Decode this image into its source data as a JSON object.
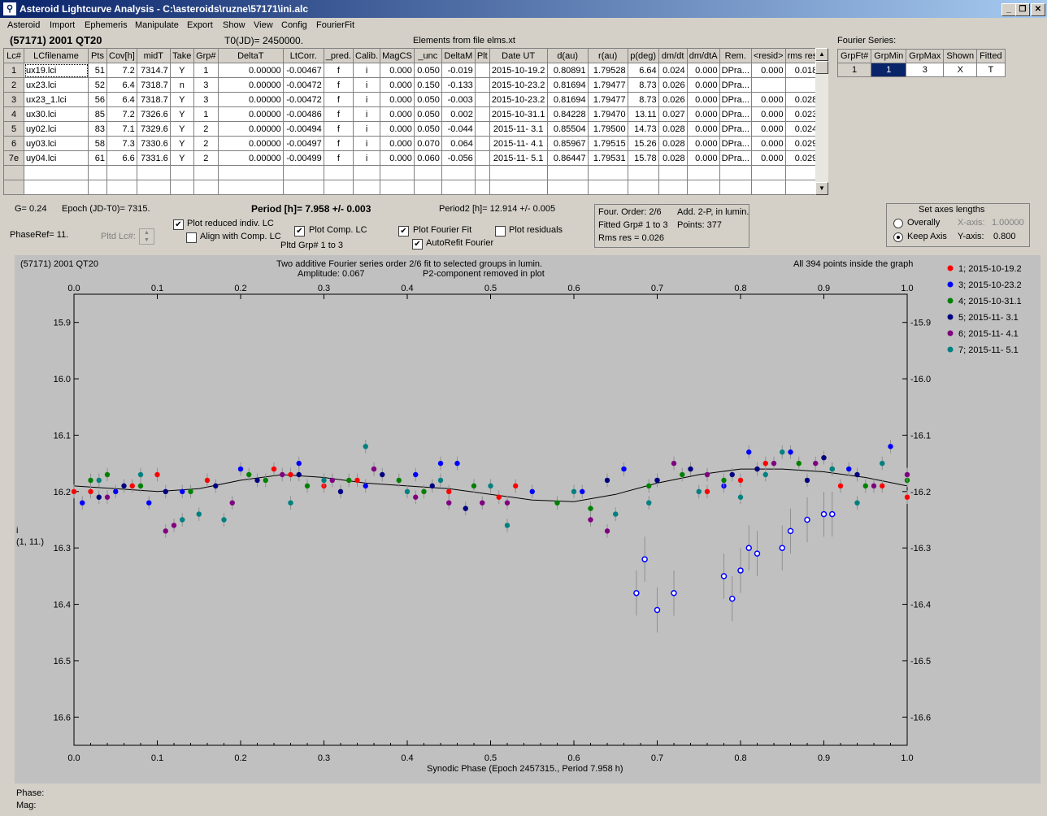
{
  "window": {
    "title": "Asteroid Lightcurve Analysis - C:\\asteroids\\ruzne\\57171\\ini.alc",
    "minimize": "_",
    "maximize": "❐",
    "close": "✕"
  },
  "menu": [
    "Asteroid",
    "Import",
    "Ephemeris",
    "Manipulate",
    "Export",
    "Show",
    "View",
    "Config",
    "FourierFit"
  ],
  "header": {
    "object": "(57171) 2001 QT20",
    "t0": "T0(JD)= 2450000.",
    "elements": "Elements from file elms.xt"
  },
  "table": {
    "columns": [
      "Lc#",
      "LCfilename",
      "Pts",
      "Cov[h]",
      "midT",
      "Take",
      "Grp#",
      "DeltaT",
      "LtCorr.",
      "_pred.",
      "Calib.",
      "MagCS",
      "_unc",
      "DeltaM",
      "Plt",
      "Date UT",
      "d(au)",
      "r(au)",
      "p(deg)",
      "dm/dt",
      "dm/dtA",
      "Rem.",
      "<resid>",
      "rms res"
    ],
    "rows": [
      [
        "1",
        "ux19.lci",
        "51",
        "7.2",
        "7314.7",
        "Y",
        "1",
        "0.00000",
        "-0.00467",
        "f",
        "i",
        "0.000",
        "0.050",
        "-0.019",
        "",
        "2015-10-19.2",
        "0.80891",
        "1.79528",
        "6.64",
        "0.024",
        "0.000",
        "DPra...",
        "0.000",
        "0.018"
      ],
      [
        "2",
        "ux23.lci",
        "52",
        "6.4",
        "7318.7",
        "n",
        "3",
        "0.00000",
        "-0.00472",
        "f",
        "i",
        "0.000",
        "0.150",
        "-0.133",
        "",
        "2015-10-23.2",
        "0.81694",
        "1.79477",
        "8.73",
        "0.026",
        "0.000",
        "DPra...",
        "",
        ""
      ],
      [
        "3",
        "ux23_1.lci",
        "56",
        "6.4",
        "7318.7",
        "Y",
        "3",
        "0.00000",
        "-0.00472",
        "f",
        "i",
        "0.000",
        "0.050",
        "-0.003",
        "",
        "2015-10-23.2",
        "0.81694",
        "1.79477",
        "8.73",
        "0.026",
        "0.000",
        "DPra...",
        "0.000",
        "0.028"
      ],
      [
        "4",
        "ux30.lci",
        "85",
        "7.2",
        "7326.6",
        "Y",
        "1",
        "0.00000",
        "-0.00486",
        "f",
        "i",
        "0.000",
        "0.050",
        "0.002",
        "",
        "2015-10-31.1",
        "0.84228",
        "1.79470",
        "13.11",
        "0.027",
        "0.000",
        "DPra...",
        "0.000",
        "0.023"
      ],
      [
        "5",
        "uy02.lci",
        "83",
        "7.1",
        "7329.6",
        "Y",
        "2",
        "0.00000",
        "-0.00494",
        "f",
        "i",
        "0.000",
        "0.050",
        "-0.044",
        "",
        "2015-11- 3.1",
        "0.85504",
        "1.79500",
        "14.73",
        "0.028",
        "0.000",
        "DPra...",
        "0.000",
        "0.024"
      ],
      [
        "6",
        "uy03.lci",
        "58",
        "7.3",
        "7330.6",
        "Y",
        "2",
        "0.00000",
        "-0.00497",
        "f",
        "i",
        "0.000",
        "0.070",
        "0.064",
        "",
        "2015-11- 4.1",
        "0.85967",
        "1.79515",
        "15.26",
        "0.028",
        "0.000",
        "DPra...",
        "0.000",
        "0.029"
      ],
      [
        "7e",
        "uy04.lci",
        "61",
        "6.6",
        "7331.6",
        "Y",
        "2",
        "0.00000",
        "-0.00499",
        "f",
        "i",
        "0.000",
        "0.060",
        "-0.056",
        "",
        "2015-11- 5.1",
        "0.86447",
        "1.79531",
        "15.78",
        "0.028",
        "0.000",
        "DPra...",
        "0.000",
        "0.029"
      ]
    ]
  },
  "fourier": {
    "label": "Fourier Series:",
    "columns": [
      "GrpFt#",
      "GrpMin",
      "GrpMax",
      "Shown",
      "Fitted"
    ],
    "row": [
      "1",
      "1",
      "3",
      "X",
      "T"
    ]
  },
  "info": {
    "g": "G= 0.24",
    "epoch": "Epoch (JD-T0)= 7315.",
    "period": "Period [h]= 7.958 +/- 0.003",
    "period2": "Period2 [h]= 12.914 +/- 0.005",
    "phaseref": "PhaseRef= 11.",
    "pltd_lc": "Pltd Lc#:",
    "plot_reduced": "Plot reduced indiv. LC",
    "align": "Align with Comp. LC",
    "plot_comp": "Plot Comp. LC",
    "pltd_grp": "Pltd Grp#  1   to   3",
    "plot_fourier": "Plot Fourier Fit",
    "autorefit": "AutoRefit Fourier",
    "plot_resid": "Plot residuals",
    "four_order": "Four. Order:  2/6",
    "add2p": "Add. 2-P, in lumin.",
    "fitted_grp": "Fitted Grp# 1 to 3",
    "points": "Points: 377",
    "rms": "Rms res     = 0.026"
  },
  "axes_box": {
    "title": "Set axes lengths",
    "overall": "Overally",
    "keep": "Keep Axis",
    "xaxis_label": "X-axis:",
    "xaxis_val": "1.00000",
    "yaxis_label": "Y-axis:",
    "yaxis_val": "0.800"
  },
  "plot": {
    "title_left": "(57171) 2001 QT20",
    "title_center1": "Two additive Fourier series order 2/6 fit to selected groups in lumin.",
    "title_center2a": "Amplitude: 0.067",
    "title_center2b": "P2-component removed in plot",
    "title_right": "All 394 points inside the graph",
    "ylabel1": "i",
    "ylabel2": "(1, 11.)",
    "xlabel": "Synodic Phase (Epoch 2457315., Period 7.958 h)",
    "xticks": [
      "0.0",
      "0.1",
      "0.2",
      "0.3",
      "0.4",
      "0.5",
      "0.6",
      "0.7",
      "0.8",
      "0.9",
      "1.0"
    ],
    "yticks": [
      "15.9",
      "16.0",
      "16.1",
      "16.2",
      "16.3",
      "16.4",
      "16.5",
      "16.6"
    ]
  },
  "footer": {
    "phase": "Phase:",
    "mag": "Mag:"
  },
  "chart_data": {
    "type": "scatter",
    "title": "Two additive Fourier series order 2/6 fit to selected groups in lumin.",
    "xlabel": "Synodic Phase (Epoch 2457315., Period 7.958 h)",
    "ylabel": "i",
    "xlim": [
      0.0,
      1.0
    ],
    "ylim": [
      15.85,
      16.65
    ],
    "y_inverted": true,
    "grid": false,
    "legend": "right",
    "fit_curve": {
      "x": [
        0.0,
        0.05,
        0.1,
        0.15,
        0.2,
        0.25,
        0.3,
        0.35,
        0.4,
        0.45,
        0.5,
        0.55,
        0.6,
        0.65,
        0.7,
        0.75,
        0.8,
        0.85,
        0.9,
        0.95,
        1.0
      ],
      "y": [
        16.19,
        16.195,
        16.2,
        16.195,
        16.18,
        16.17,
        16.175,
        16.185,
        16.19,
        16.195,
        16.205,
        16.215,
        16.218,
        16.205,
        16.185,
        16.17,
        16.16,
        16.16,
        16.165,
        16.175,
        16.19
      ]
    },
    "series": [
      {
        "name": "1; 2015-10-19.2",
        "color": "#ff0000",
        "x": [
          0.0,
          0.02,
          0.07,
          0.1,
          0.16,
          0.24,
          0.26,
          0.3,
          0.34,
          0.45,
          0.51,
          0.53,
          0.76,
          0.8,
          0.83,
          0.92,
          0.97,
          1.0
        ],
        "y": [
          16.2,
          16.2,
          16.19,
          16.17,
          16.18,
          16.16,
          16.17,
          16.19,
          16.18,
          16.2,
          16.21,
          16.19,
          16.2,
          16.18,
          16.15,
          16.19,
          16.19,
          16.21
        ]
      },
      {
        "name": "3; 2015-10-23.2",
        "color": "#0000ff",
        "x": [
          0.01,
          0.05,
          0.09,
          0.13,
          0.2,
          0.27,
          0.35,
          0.41,
          0.44,
          0.46,
          0.55,
          0.61,
          0.66,
          0.7,
          0.78,
          0.81,
          0.86,
          0.93,
          0.98
        ],
        "y": [
          16.22,
          16.2,
          16.22,
          16.2,
          16.16,
          16.15,
          16.19,
          16.17,
          16.15,
          16.15,
          16.2,
          16.2,
          16.16,
          16.18,
          16.19,
          16.13,
          16.13,
          16.16,
          16.12
        ]
      },
      {
        "name": "4; 2015-10-31.1",
        "color": "#008000",
        "x": [
          0.02,
          0.04,
          0.08,
          0.14,
          0.21,
          0.23,
          0.28,
          0.33,
          0.39,
          0.42,
          0.48,
          0.58,
          0.62,
          0.69,
          0.73,
          0.78,
          0.87,
          0.91,
          0.95,
          1.0
        ],
        "y": [
          16.18,
          16.17,
          16.19,
          16.2,
          16.17,
          16.18,
          16.19,
          16.18,
          16.18,
          16.2,
          16.19,
          16.22,
          16.23,
          16.19,
          16.17,
          16.18,
          16.15,
          16.16,
          16.19,
          16.18
        ]
      },
      {
        "name": "5; 2015-11- 3.1",
        "color": "#000080",
        "x": [
          0.03,
          0.06,
          0.11,
          0.17,
          0.22,
          0.27,
          0.32,
          0.37,
          0.43,
          0.47,
          0.64,
          0.7,
          0.74,
          0.79,
          0.82,
          0.88,
          0.9,
          0.94
        ],
        "y": [
          16.21,
          16.19,
          16.2,
          16.19,
          16.18,
          16.17,
          16.2,
          16.17,
          16.19,
          16.23,
          16.18,
          16.18,
          16.16,
          16.17,
          16.16,
          16.18,
          16.14,
          16.17
        ]
      },
      {
        "name": "6; 2015-11- 4.1",
        "color": "#800080",
        "x": [
          0.04,
          0.11,
          0.12,
          0.19,
          0.25,
          0.31,
          0.36,
          0.41,
          0.45,
          0.49,
          0.52,
          0.62,
          0.64,
          0.72,
          0.76,
          0.84,
          0.89,
          0.96,
          1.0
        ],
        "y": [
          16.21,
          16.27,
          16.26,
          16.22,
          16.17,
          16.18,
          16.16,
          16.21,
          16.22,
          16.22,
          16.22,
          16.25,
          16.27,
          16.15,
          16.17,
          16.15,
          16.15,
          16.19,
          16.17
        ]
      },
      {
        "name": "7; 2015-11- 5.1",
        "color": "#008080",
        "x": [
          0.03,
          0.08,
          0.13,
          0.15,
          0.18,
          0.26,
          0.3,
          0.35,
          0.4,
          0.44,
          0.5,
          0.52,
          0.6,
          0.65,
          0.69,
          0.75,
          0.8,
          0.83,
          0.85,
          0.91,
          0.94,
          0.97
        ],
        "y": [
          16.18,
          16.17,
          16.25,
          16.24,
          16.25,
          16.22,
          16.18,
          16.12,
          16.2,
          16.18,
          16.19,
          16.26,
          16.2,
          16.24,
          16.22,
          16.2,
          16.21,
          16.17,
          16.13,
          16.16,
          16.22,
          16.15
        ]
      },
      {
        "name": "2 (excluded)",
        "color": "#0000ff",
        "marker": "x",
        "x": [
          0.675,
          0.685,
          0.7,
          0.72,
          0.78,
          0.79,
          0.8,
          0.81,
          0.82,
          0.85,
          0.86,
          0.88,
          0.9,
          0.91
        ],
        "y": [
          16.38,
          16.32,
          16.41,
          16.38,
          16.35,
          16.39,
          16.34,
          16.3,
          16.31,
          16.3,
          16.27,
          16.25,
          16.24,
          16.24
        ]
      }
    ]
  }
}
